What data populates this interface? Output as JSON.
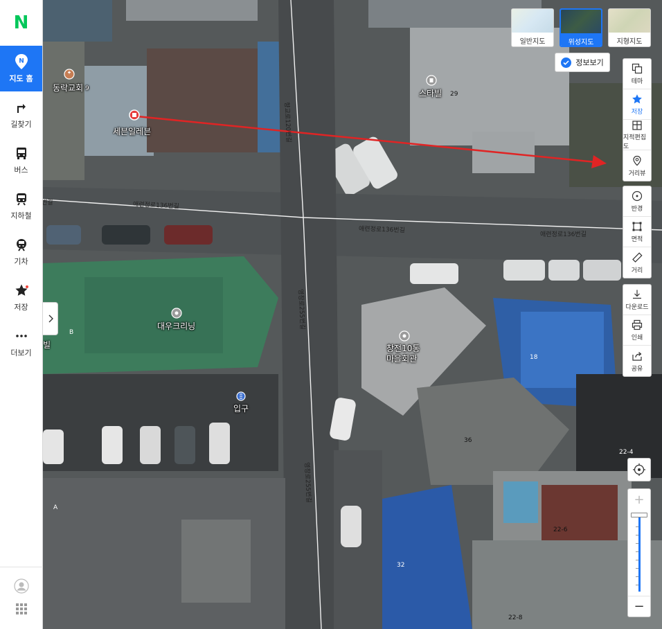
{
  "brand": {
    "logo": "N",
    "color": "#03c75a"
  },
  "sidebar": {
    "items": [
      {
        "label": "지도 홈",
        "icon": "map-pin-icon"
      },
      {
        "label": "길찾기",
        "icon": "turn-arrow-icon"
      },
      {
        "label": "버스",
        "icon": "bus-icon"
      },
      {
        "label": "지하철",
        "icon": "subway-icon"
      },
      {
        "label": "기차",
        "icon": "train-icon"
      },
      {
        "label": "저장",
        "icon": "star-icon"
      },
      {
        "label": "더보기",
        "icon": "more-dots-icon"
      }
    ]
  },
  "map_types": {
    "items": [
      {
        "label": "일반지도"
      },
      {
        "label": "위성지도"
      },
      {
        "label": "지형지도"
      }
    ],
    "selected": "위성지도"
  },
  "info_toggle": {
    "label": "정보보기",
    "checked": true
  },
  "tools": {
    "group1": [
      "테마",
      "저장",
      "지적편집도",
      "거리뷰"
    ],
    "group2": [
      "반경",
      "면적",
      "거리"
    ],
    "group3": [
      "다운로드",
      "인쇄",
      "공유"
    ]
  },
  "map": {
    "places": {
      "church": "동락교회",
      "church_num": "9",
      "seven_eleven": "세븐일레븐",
      "starvill": "스타빌",
      "starvill_num": "29",
      "daewoo": "대우크리닝",
      "hall_line1": "창전10통",
      "hall_line2": "마을회관",
      "entrance": "입구"
    },
    "roads": {
      "r1": "애련정로136번길",
      "r2": "애련정로136번길",
      "r3": "애련정로136번길",
      "r4": "번길",
      "v1": "향교로120번길",
      "v2": "영창로255번길",
      "v3": "영창로255번길"
    },
    "numbers": [
      "36",
      "18",
      "32",
      "22-4",
      "22-6",
      "22-8",
      "A",
      "B"
    ],
    "edge_label": "빌"
  },
  "colors": {
    "accent": "#1e76f5",
    "arrow": "#e02424"
  }
}
